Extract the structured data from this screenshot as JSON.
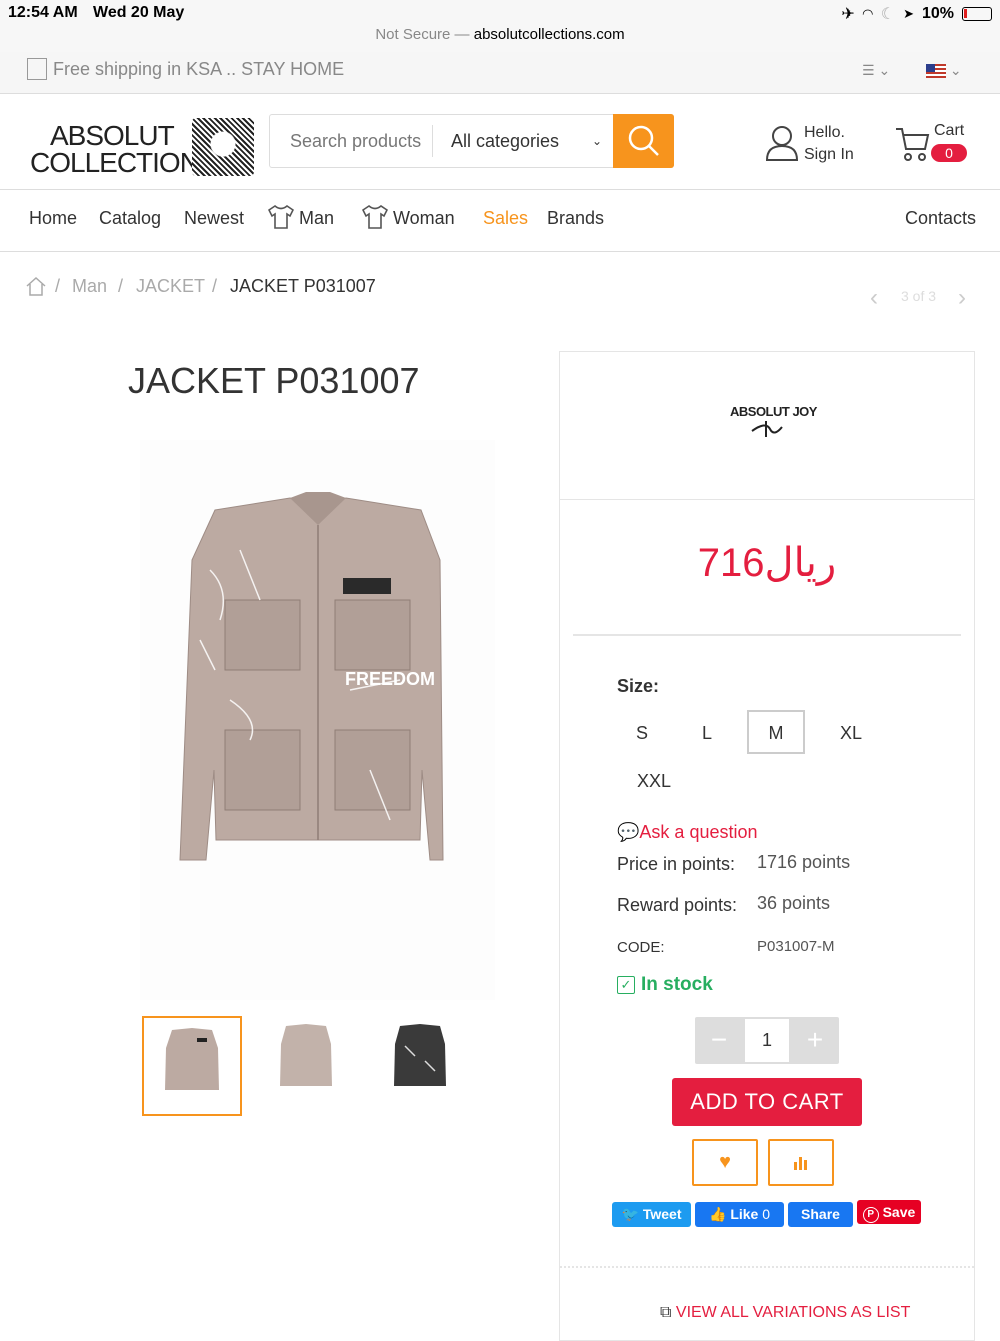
{
  "status": {
    "time": "12:54 AM",
    "date": "Wed 20 May",
    "not_secure": "Not Secure —",
    "domain": "absolutcollections.com",
    "battery": "10%"
  },
  "promo": {
    "text": "Free shipping in KSA .. STAY HOME"
  },
  "header": {
    "logo_line1": "ABSOLUT",
    "logo_line2": "COLLECTION",
    "search_placeholder": "Search products",
    "category_label": "All categories",
    "account_hello": "Hello.",
    "account_signin": "Sign In",
    "cart_label": "Cart",
    "cart_count": "0"
  },
  "nav": {
    "home": "Home",
    "catalog": "Catalog",
    "newest": "Newest",
    "man": "Man",
    "woman": "Woman",
    "sales": "Sales",
    "brands": "Brands",
    "contacts": "Contacts"
  },
  "breadcrumb": {
    "sep": "/",
    "c1": "Man",
    "c2": "JACKET",
    "current": "JACKET P031007",
    "pager": "3 of 3"
  },
  "product": {
    "title": "JACKET P031007",
    "brand_logo_text": "ABSOLUT JOY",
    "price": "716ريال",
    "size_label": "Size:",
    "sizes": [
      "S",
      "L",
      "M",
      "XL",
      "XXL"
    ],
    "selected_size": "M",
    "ask": "Ask a question",
    "price_points_label": "Price in points:",
    "price_points_value": "1716 points",
    "reward_points_label": "Reward points:",
    "reward_points_value": "36 points",
    "code_label": "CODE:",
    "code_value": "P031007-M",
    "stock": "In stock",
    "quantity": "1",
    "add_to_cart": "ADD TO CART",
    "view_variations": "VIEW ALL VARIATIONS AS LIST"
  },
  "social": {
    "tweet": "Tweet",
    "like": "Like",
    "like_count": "0",
    "share": "Share",
    "save": "Save"
  },
  "colors": {
    "accent": "#f7941d",
    "price_red": "#e41e3f",
    "stock_green": "#27ae60",
    "twitter": "#1d9bf0",
    "facebook": "#1877f2",
    "pinterest": "#e60023"
  }
}
